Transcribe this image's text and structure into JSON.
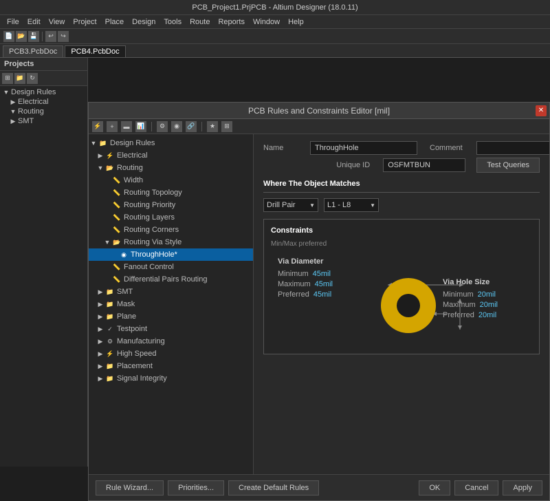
{
  "app": {
    "title": "PCB_Project1.PrjPCB - Altium Designer (18.0.11)"
  },
  "menu": {
    "items": [
      "File",
      "Edit",
      "View",
      "Project",
      "Place",
      "Design",
      "Tools",
      "Route",
      "Reports",
      "Window",
      "Help"
    ]
  },
  "tabs": [
    {
      "label": "PCB3.PcbDoc",
      "active": false
    },
    {
      "label": "PCB4.PcbDoc",
      "active": true
    }
  ],
  "left_panel": {
    "title": "Projects"
  },
  "dialog": {
    "title": "PCB Rules and Constraints Editor [mil]",
    "tree": [
      {
        "label": "Design Rules",
        "indent": 0,
        "expandable": true,
        "expanded": true,
        "icon": "folder"
      },
      {
        "label": "Electrical",
        "indent": 1,
        "expandable": true,
        "expanded": false,
        "icon": "folder"
      },
      {
        "label": "Routing",
        "indent": 1,
        "expandable": true,
        "expanded": true,
        "icon": "folder"
      },
      {
        "label": "Width",
        "indent": 2,
        "expandable": false,
        "icon": "rule"
      },
      {
        "label": "Routing Topology",
        "indent": 2,
        "expandable": false,
        "icon": "rule"
      },
      {
        "label": "Routing Priority",
        "indent": 2,
        "expandable": false,
        "icon": "rule"
      },
      {
        "label": "Routing Layers",
        "indent": 2,
        "expandable": false,
        "icon": "rule"
      },
      {
        "label": "Routing Corners",
        "indent": 2,
        "expandable": false,
        "icon": "rule"
      },
      {
        "label": "Routing Via Style",
        "indent": 2,
        "expandable": true,
        "expanded": true,
        "icon": "folder"
      },
      {
        "label": "ThroughHole*",
        "indent": 3,
        "expandable": false,
        "icon": "rule",
        "selected": true
      },
      {
        "label": "Fanout Control",
        "indent": 2,
        "expandable": false,
        "icon": "rule"
      },
      {
        "label": "Differential Pairs Routing",
        "indent": 2,
        "expandable": false,
        "icon": "rule"
      },
      {
        "label": "SMT",
        "indent": 1,
        "expandable": true,
        "expanded": false,
        "icon": "folder"
      },
      {
        "label": "Mask",
        "indent": 1,
        "expandable": true,
        "expanded": false,
        "icon": "folder"
      },
      {
        "label": "Plane",
        "indent": 1,
        "expandable": true,
        "expanded": false,
        "icon": "folder"
      },
      {
        "label": "Testpoint",
        "indent": 1,
        "expandable": true,
        "expanded": false,
        "icon": "folder"
      },
      {
        "label": "Manufacturing",
        "indent": 1,
        "expandable": true,
        "expanded": false,
        "icon": "folder"
      },
      {
        "label": "High Speed",
        "indent": 1,
        "expandable": true,
        "expanded": false,
        "icon": "folder"
      },
      {
        "label": "Placement",
        "indent": 1,
        "expandable": true,
        "expanded": false,
        "icon": "folder"
      },
      {
        "label": "Signal Integrity",
        "indent": 1,
        "expandable": true,
        "expanded": false,
        "icon": "folder"
      }
    ],
    "form": {
      "name_label": "Name",
      "name_value": "ThroughHole",
      "comment_label": "Comment",
      "comment_value": "",
      "unique_id_label": "Unique ID",
      "unique_id_value": "OSFMTBUN",
      "test_queries_btn": "Test Queries",
      "where_matches_title": "Where The Object Matches",
      "drill_pair_value": "Drill Pair",
      "layer_range": "L1 - L8",
      "constraints_title": "Constraints",
      "min_max_label": "Min/Max preferred",
      "via_diameter_title": "Via Diameter",
      "via_diameter_min_label": "Minimum",
      "via_diameter_min_val": "45mil",
      "via_diameter_max_label": "Maximum",
      "via_diameter_max_val": "45mil",
      "via_diameter_pref_label": "Preferred",
      "via_diameter_pref_val": "45mil",
      "via_hole_title": "Via Hole Size",
      "via_hole_min_label": "Minimum",
      "via_hole_min_val": "20mil",
      "via_hole_max_label": "Maximum",
      "via_hole_max_val": "20mil",
      "via_hole_pref_label": "Preferred",
      "via_hole_pref_val": "20mil"
    },
    "footer": {
      "rule_wizard_btn": "Rule Wizard...",
      "priorities_btn": "Priorities...",
      "create_default_btn": "Create Default Rules",
      "ok_btn": "OK",
      "cancel_btn": "Cancel",
      "apply_btn": "Apply"
    }
  },
  "colors": {
    "via_gold": "#d4a500",
    "via_hole": "#1a1a1a",
    "accent_blue": "#5bc8f5",
    "selected_bg": "#0a5fa0"
  }
}
